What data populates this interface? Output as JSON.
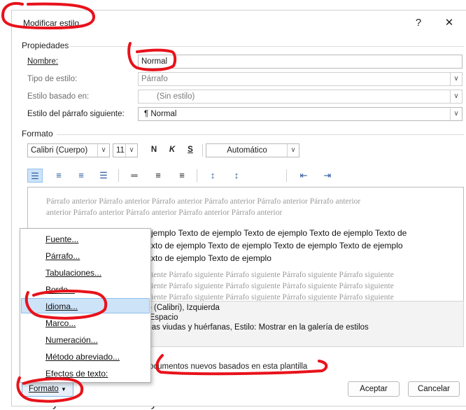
{
  "window": {
    "title": "Modificar estilo",
    "help": "?",
    "close": "✕"
  },
  "properties": {
    "section": "Propiedades",
    "name_label": "Nombre:",
    "name_value": "Normal",
    "type_label": "Tipo de estilo:",
    "type_value": "Párrafo",
    "based_label": "Estilo basado en:",
    "based_value": "(Sin estilo)",
    "next_label": "Estilo del párrafo siguiente:",
    "next_value": "¶ Normal"
  },
  "format": {
    "section": "Formato",
    "font": "Calibri (Cuerpo)",
    "size": "11",
    "bold": "N",
    "italic": "K",
    "underline": "S",
    "color": "Automático"
  },
  "preview": {
    "prev_line1": "Párrafo anterior Párrafo anterior Párrafo anterior Párrafo anterior Párrafo anterior Párrafo anterior",
    "prev_line2": "anterior Párrafo anterior Párrafo anterior Párrafo anterior Párrafo anterior",
    "main_line1": "jemplo Texto de ejemplo Texto de ejemplo Texto de ejemplo Texto de",
    "main_line2": "xto de ejemplo Texto de ejemplo Texto de ejemplo Texto de ejemplo",
    "main_line3": "xto de ejemplo Texto de ejemplo",
    "next_line1": "iente Párrafo siguiente Párrafo siguiente Párrafo siguiente Párrafo siguiente",
    "next_line2": "iente Párrafo siguiente Párrafo siguiente Párrafo siguiente Párrafo siguiente",
    "next_line3": "iente Párrafo siguiente Párrafo siguiente Párrafo siguiente Párrafo siguiente"
  },
  "description": {
    "line1": "po (Calibri), Izquierda",
    "line2": "., Espacio",
    "line3": "neas viudas y huérfanas, Estilo: Mostrar en la galería de estilos"
  },
  "template_option": "ocumentos nuevos basados en esta plantilla",
  "buttons": {
    "format": "Formato",
    "accept": "Aceptar",
    "cancel": "Cancelar"
  },
  "menu": {
    "items": [
      "Fuente...",
      "Párrafo...",
      "Tabulaciones...",
      "Borde...",
      "Idioma...",
      "Marco...",
      "Numeración...",
      "Método abreviado...",
      "Efectos de texto:"
    ],
    "highlighted_index": 4
  },
  "background_text": "tomas y estilos también ayudan a mantener su documen",
  "colors": {
    "annotation": "#e8121b",
    "highlight": "#cde3f8",
    "accent": "#2f5c9e"
  }
}
